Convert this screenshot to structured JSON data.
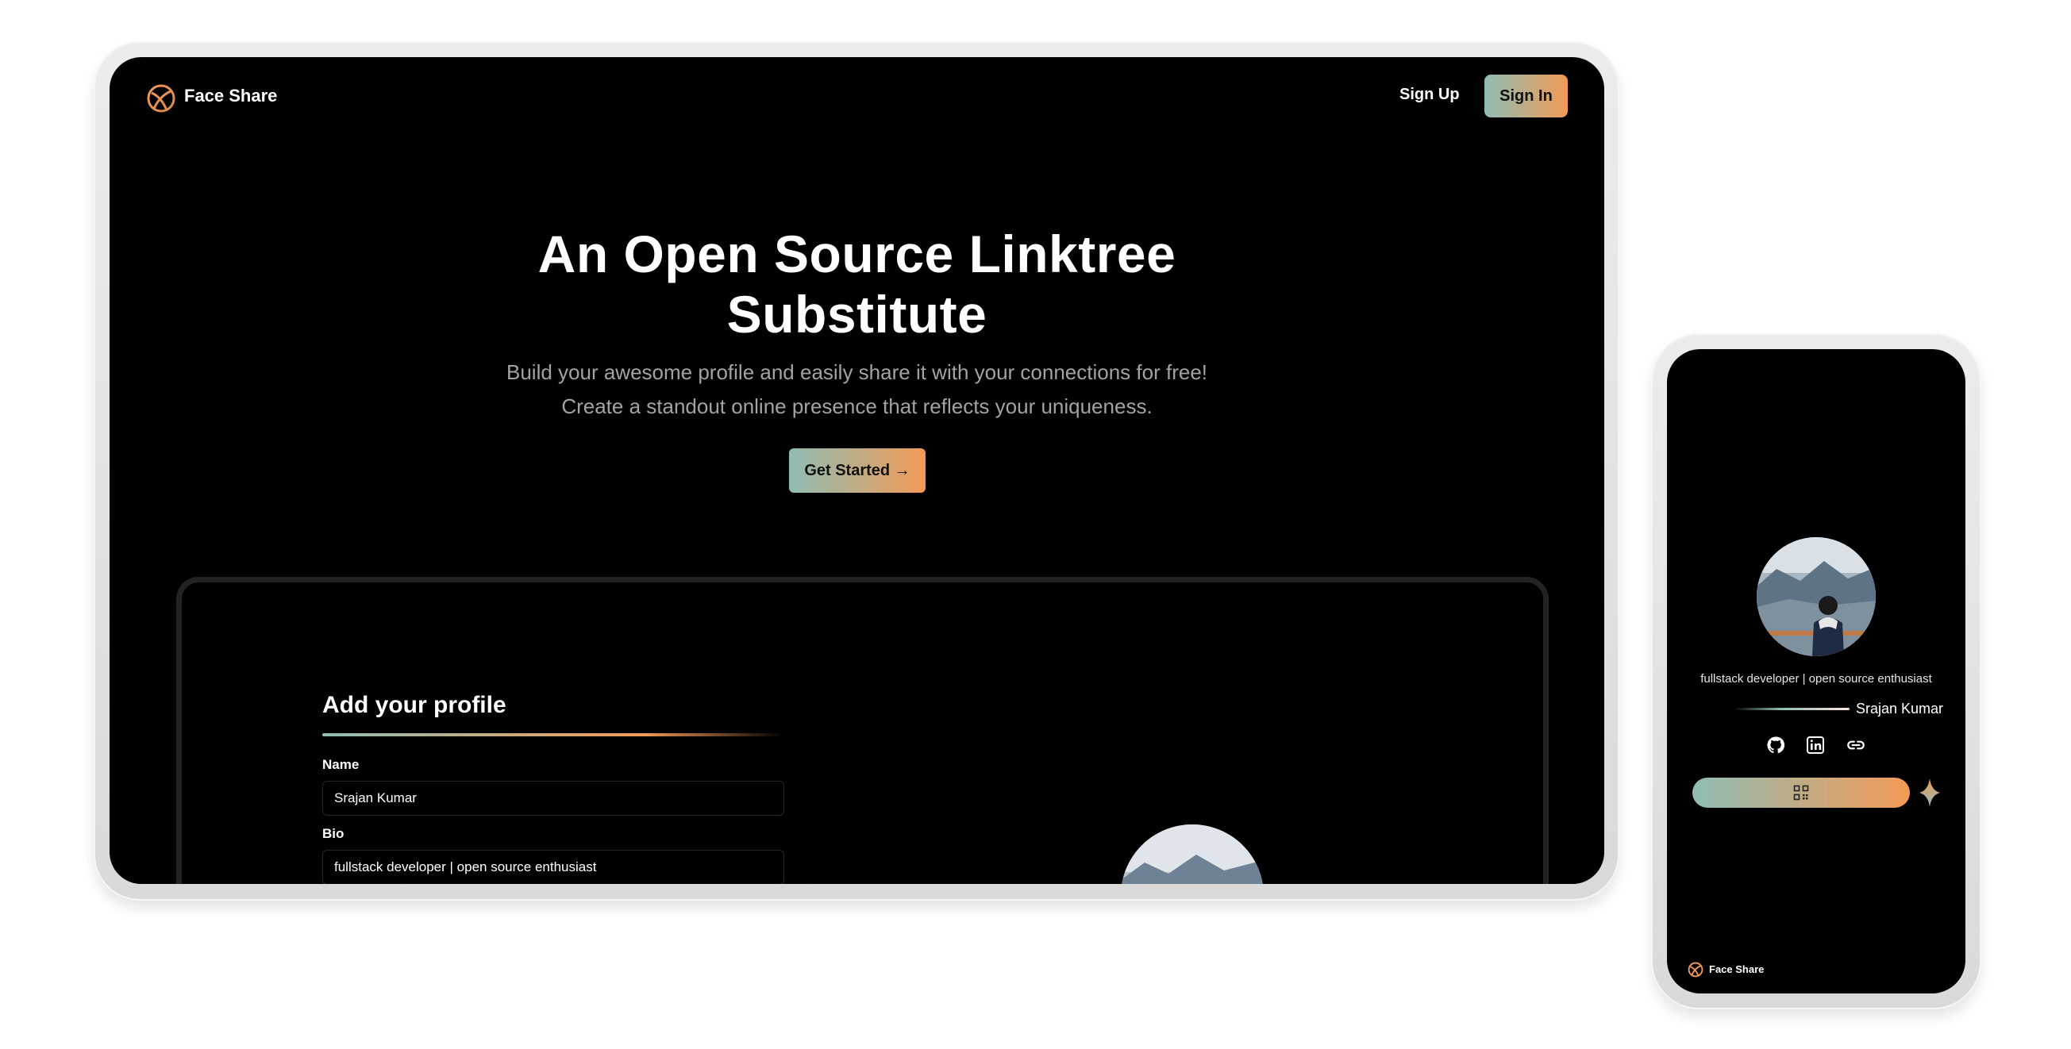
{
  "app": {
    "name": "Face Share"
  },
  "nav": {
    "sign_up": "Sign Up",
    "sign_in": "Sign In"
  },
  "hero": {
    "title_line1": "An Open Source Linktree",
    "title_line2": "Substitute",
    "subtitle_line1": "Build your awesome profile and easily share it with your connections for free!",
    "subtitle_line2": "Create a standout online presence that reflects your uniqueness.",
    "cta": "Get Started →"
  },
  "form": {
    "title": "Add your profile",
    "name_label": "Name",
    "name_value": "Srajan Kumar",
    "bio_label": "Bio",
    "bio_value": "fullstack developer | open source enthusiast"
  },
  "phone": {
    "bio": "fullstack developer | open source enthusiast",
    "name": "Srajan Kumar",
    "social_icons": [
      "github-icon",
      "linkedin-icon",
      "link-icon"
    ],
    "brand": "Face Share"
  },
  "colors": {
    "gradient_start": "#8fbdb4",
    "gradient_end": "#f29a56",
    "background": "#000000"
  }
}
